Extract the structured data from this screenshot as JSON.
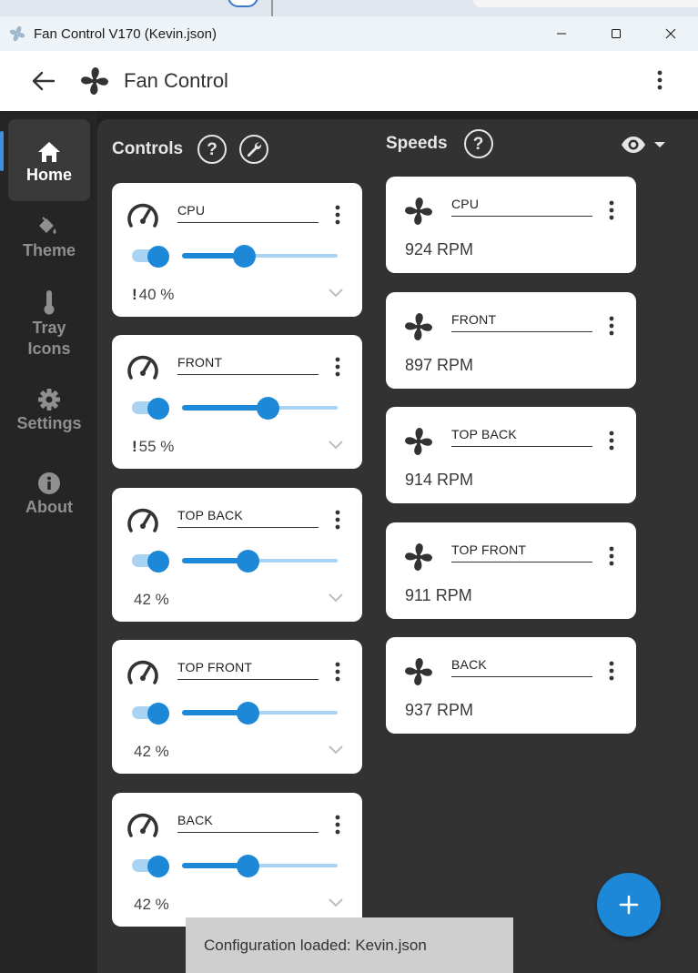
{
  "window": {
    "title": "Fan Control V170 (Kevin.json)",
    "buttons": [
      "minimize",
      "maximize",
      "close"
    ]
  },
  "appbar": {
    "title": "Fan Control"
  },
  "sidebar": {
    "items": [
      {
        "label": "Home",
        "icon": "home-icon",
        "active": true
      },
      {
        "label": "Theme",
        "icon": "paint-bucket-icon",
        "active": false
      },
      {
        "label": "Tray\nIcons",
        "icon": "thermometer-icon",
        "active": false
      },
      {
        "label": "Settings",
        "icon": "gear-icon",
        "active": false
      },
      {
        "label": "About",
        "icon": "info-icon",
        "active": false
      }
    ]
  },
  "controls": {
    "heading": "Controls",
    "help_symbol": "?",
    "cards": [
      {
        "name": "CPU",
        "enabled": true,
        "percent_label": "40 %",
        "value": 40,
        "flag": "!"
      },
      {
        "name": "FRONT",
        "enabled": true,
        "percent_label": "55 %",
        "value": 55,
        "flag": "!"
      },
      {
        "name": "TOP BACK",
        "enabled": true,
        "percent_label": "42 %",
        "value": 42,
        "flag": ""
      },
      {
        "name": "TOP FRONT",
        "enabled": true,
        "percent_label": "42 %",
        "value": 42,
        "flag": ""
      },
      {
        "name": "BACK",
        "enabled": true,
        "percent_label": "42 %",
        "value": 42,
        "flag": ""
      }
    ]
  },
  "speeds": {
    "heading": "Speeds",
    "help_symbol": "?",
    "cards": [
      {
        "name": "CPU",
        "rpm": "924 RPM"
      },
      {
        "name": "FRONT",
        "rpm": "897 RPM"
      },
      {
        "name": "TOP BACK",
        "rpm": "914 RPM"
      },
      {
        "name": "TOP FRONT",
        "rpm": "911 RPM"
      },
      {
        "name": "BACK",
        "rpm": "937 RPM"
      }
    ]
  },
  "snackbar": {
    "message": "Configuration loaded: Kevin.json"
  },
  "colors": {
    "accent": "#1e88d8",
    "accent_light": "#a9d3f3",
    "sidebar_bg": "#252525",
    "main_bg": "#323232",
    "card_bg": "#ffffff"
  }
}
